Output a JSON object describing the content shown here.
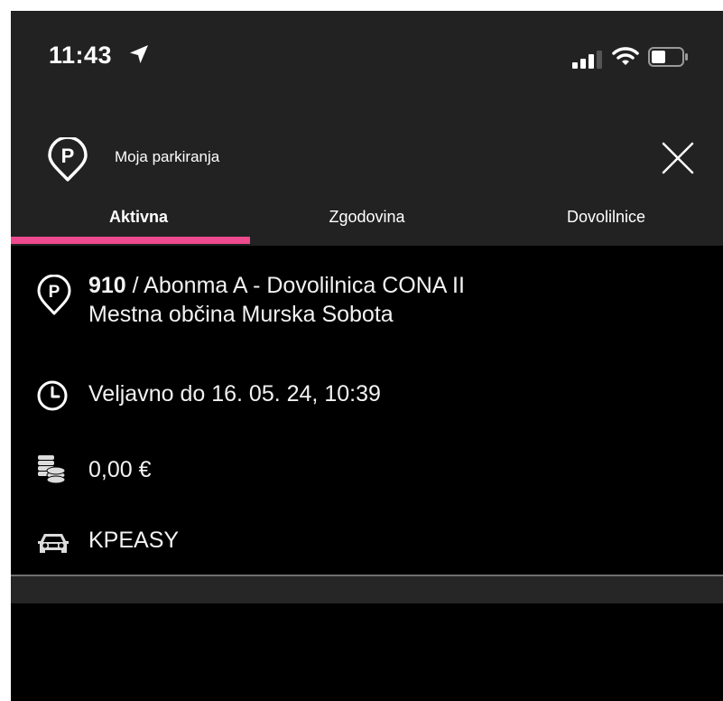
{
  "status_bar": {
    "time": "11:43",
    "icons": [
      "location-arrow-icon",
      "signal-icon",
      "wifi-icon",
      "battery-icon"
    ]
  },
  "header": {
    "title": "Moja parkiranja",
    "icon": "parking-pin-icon",
    "close_icon": "close-icon"
  },
  "tabs": [
    {
      "label": "Aktivna",
      "active": true
    },
    {
      "label": "Zgodovina",
      "active": false
    },
    {
      "label": "Dovolilnice",
      "active": false
    }
  ],
  "parking": {
    "zone_number": "910",
    "zone_name": " / Abonma A - Dovolilnica CONA II",
    "municipality": "Mestna občina Murska Sobota",
    "valid_until": "Veljavno do 16. 05. 24, 10:39",
    "price": "0,00 €",
    "plate": "KPEASY"
  },
  "colors": {
    "accent": "#ee4a8e",
    "header_bg": "#222222",
    "content_bg": "#000000",
    "text": "#ffffff"
  }
}
